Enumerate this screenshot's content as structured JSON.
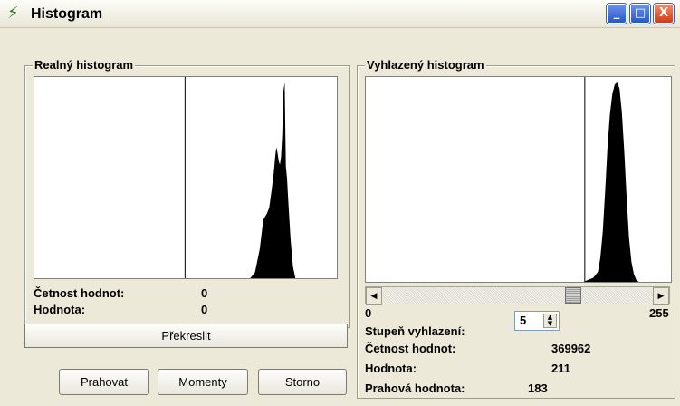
{
  "window": {
    "title": "Histogram",
    "icon": "app-icon-lightning",
    "controls": {
      "minimize": "_",
      "maximize": "□",
      "close": "X"
    }
  },
  "real_panel": {
    "title": "Realný histogram",
    "frequency_label": "Četnost hodnot:",
    "frequency_value": "0",
    "value_label": "Hodnota:",
    "value_value": "0",
    "redraw_button": "Překreslit"
  },
  "smooth_panel": {
    "title": "Vyhlazený histogram",
    "range_min": "0",
    "range_max": "255",
    "slider_value": 183,
    "smoothing_label": "Stupeň vyhlazení:",
    "smoothing_value": "5",
    "frequency_label": "Četnost hodnot:",
    "frequency_value": "369962",
    "value_label": "Hodnota:",
    "value_value": "211",
    "threshold_label": "Prahová hodnota:",
    "threshold_value": "183"
  },
  "buttons": {
    "threshold": "Prahovat",
    "moments": "Momenty",
    "cancel": "Storno"
  },
  "chart_data": [
    {
      "type": "area",
      "x_range": [
        0,
        255
      ],
      "y_range": [
        0,
        1
      ],
      "threshold_line": 127,
      "x": [
        182,
        186,
        190,
        193,
        196,
        198,
        200,
        202,
        203,
        204,
        205,
        206,
        207,
        208,
        209,
        210,
        211,
        212,
        213,
        214,
        216,
        218,
        220
      ],
      "values": [
        0,
        0.03,
        0.15,
        0.3,
        0.33,
        0.36,
        0.45,
        0.55,
        0.62,
        0.67,
        0.64,
        0.6,
        0.58,
        0.62,
        0.73,
        0.96,
        1.0,
        0.57,
        0.51,
        0.4,
        0.2,
        0.06,
        0
      ]
    },
    {
      "type": "area",
      "x_range": [
        0,
        255
      ],
      "y_range": [
        0,
        1
      ],
      "threshold_line": 183,
      "x": [
        182,
        186,
        190,
        194,
        196,
        198,
        200,
        202,
        204,
        206,
        208,
        210,
        212,
        214,
        216,
        218,
        220,
        222,
        224,
        226,
        228
      ],
      "values": [
        0,
        0.01,
        0.02,
        0.05,
        0.12,
        0.25,
        0.45,
        0.68,
        0.84,
        0.94,
        0.99,
        1.0,
        0.97,
        0.85,
        0.65,
        0.42,
        0.22,
        0.1,
        0.04,
        0.01,
        0
      ]
    }
  ]
}
